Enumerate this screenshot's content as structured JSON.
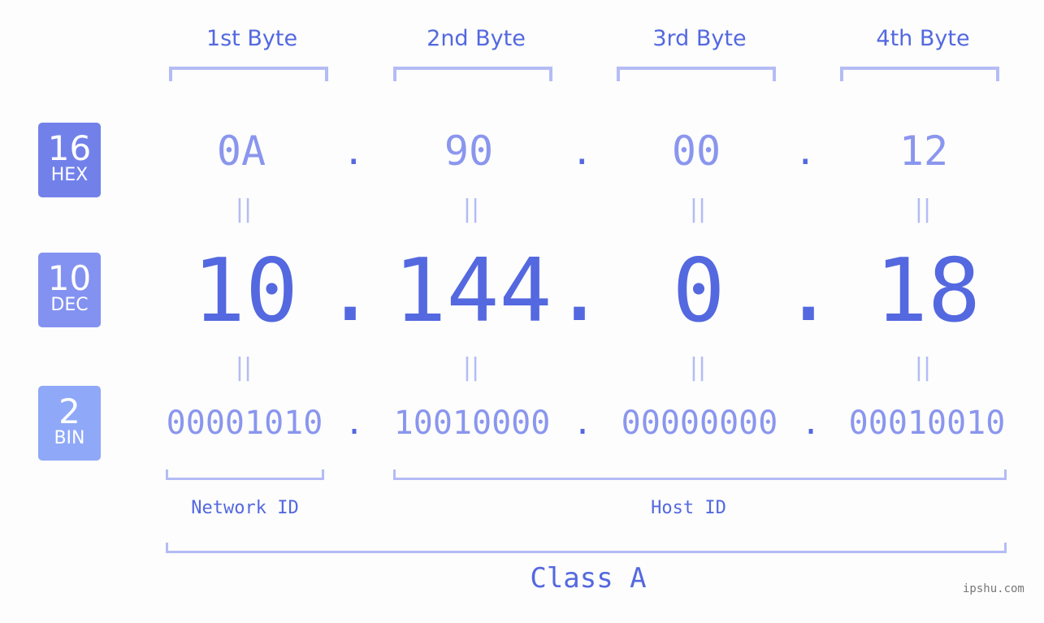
{
  "bytes": [
    {
      "label": "1st Byte",
      "hex": "0A",
      "dec": "10",
      "bin": "00001010"
    },
    {
      "label": "2nd Byte",
      "hex": "90",
      "dec": "144",
      "bin": "10010000"
    },
    {
      "label": "3rd Byte",
      "hex": "00",
      "dec": "0",
      "bin": "00000000"
    },
    {
      "label": "4th Byte",
      "hex": "12",
      "dec": "18",
      "bin": "00010010"
    }
  ],
  "separator": ".",
  "equals_glyph": "||",
  "badges": {
    "hex": {
      "num": "16",
      "label": "HEX",
      "color": "#7281ea"
    },
    "dec": {
      "num": "10",
      "label": "DEC",
      "color": "#8392f0"
    },
    "bin": {
      "num": "2",
      "label": "BIN",
      "color": "#8fa8f8"
    }
  },
  "segments": {
    "network": "Network ID",
    "host": "Host ID"
  },
  "ip_class": "Class A",
  "watermark": "ipshu.com",
  "colors": {
    "accent": "#5468e0",
    "light_text": "#8a96ee",
    "bracket": "#b4bcf5"
  }
}
